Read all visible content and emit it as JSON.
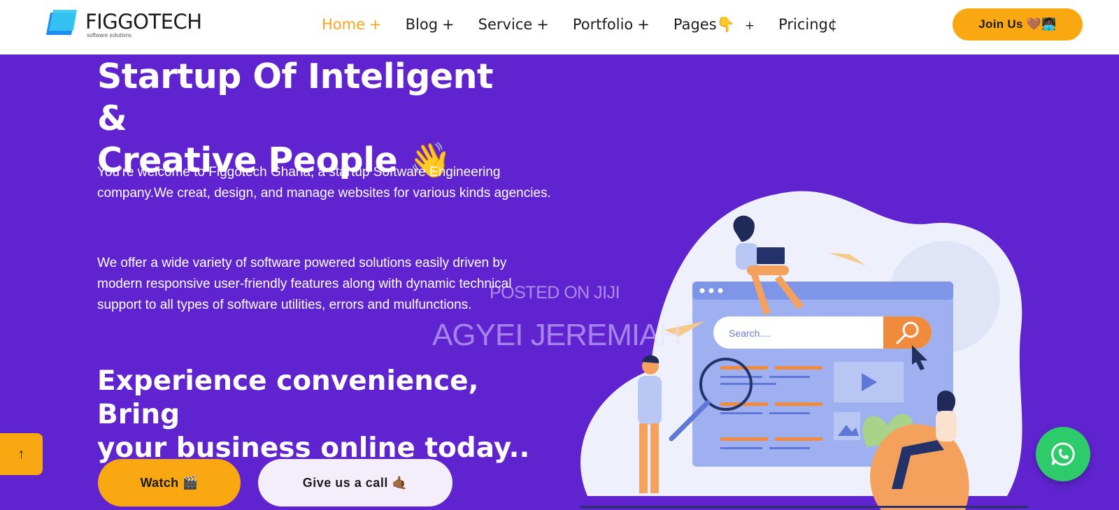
{
  "brand": {
    "name": "FIGGOTECH",
    "tagline": "software solutions"
  },
  "nav": {
    "items": [
      {
        "label": "Home",
        "suffix": "+",
        "active": true
      },
      {
        "label": "Blog",
        "suffix": "+"
      },
      {
        "label": "Service",
        "suffix": "+"
      },
      {
        "label": "Portfolio",
        "suffix": "+"
      },
      {
        "label": "Pages👇",
        "suffix": "+"
      },
      {
        "label": "Pricing¢",
        "suffix": ""
      }
    ],
    "join_label": "Join Us 🤎🧑🏿‍💻"
  },
  "hero": {
    "title_line1": "Startup Of Inteligent &",
    "title_line2": "Creative People 👋",
    "paragraph1": "You're welcome to Figgotech Ghana, a startup Software Engineering company.We creat, design, and manage websites for various kinds agencies.",
    "paragraph2": "We offer a wide variety of software powered solutions easily driven by modern responsive user-friendly features along with dynamic technical support to all types of software utilities, errors and mulfunctions.",
    "cta_line1": "Experience convenience, Bring",
    "cta_line2": "your business online today..",
    "watch_label": "Watch 🎬",
    "call_label": "Give us a call 🤙🏾"
  },
  "illustration": {
    "search_placeholder": "Search...."
  },
  "floating": {
    "scroll_top_glyph": "↑"
  },
  "watermark": {
    "line1": "POSTED ON JIJI",
    "line2": "AGYEI JEREMIAH"
  },
  "colors": {
    "primary": "#5f24d0",
    "accent": "#f9a812",
    "whatsapp": "#2ecb6a"
  }
}
